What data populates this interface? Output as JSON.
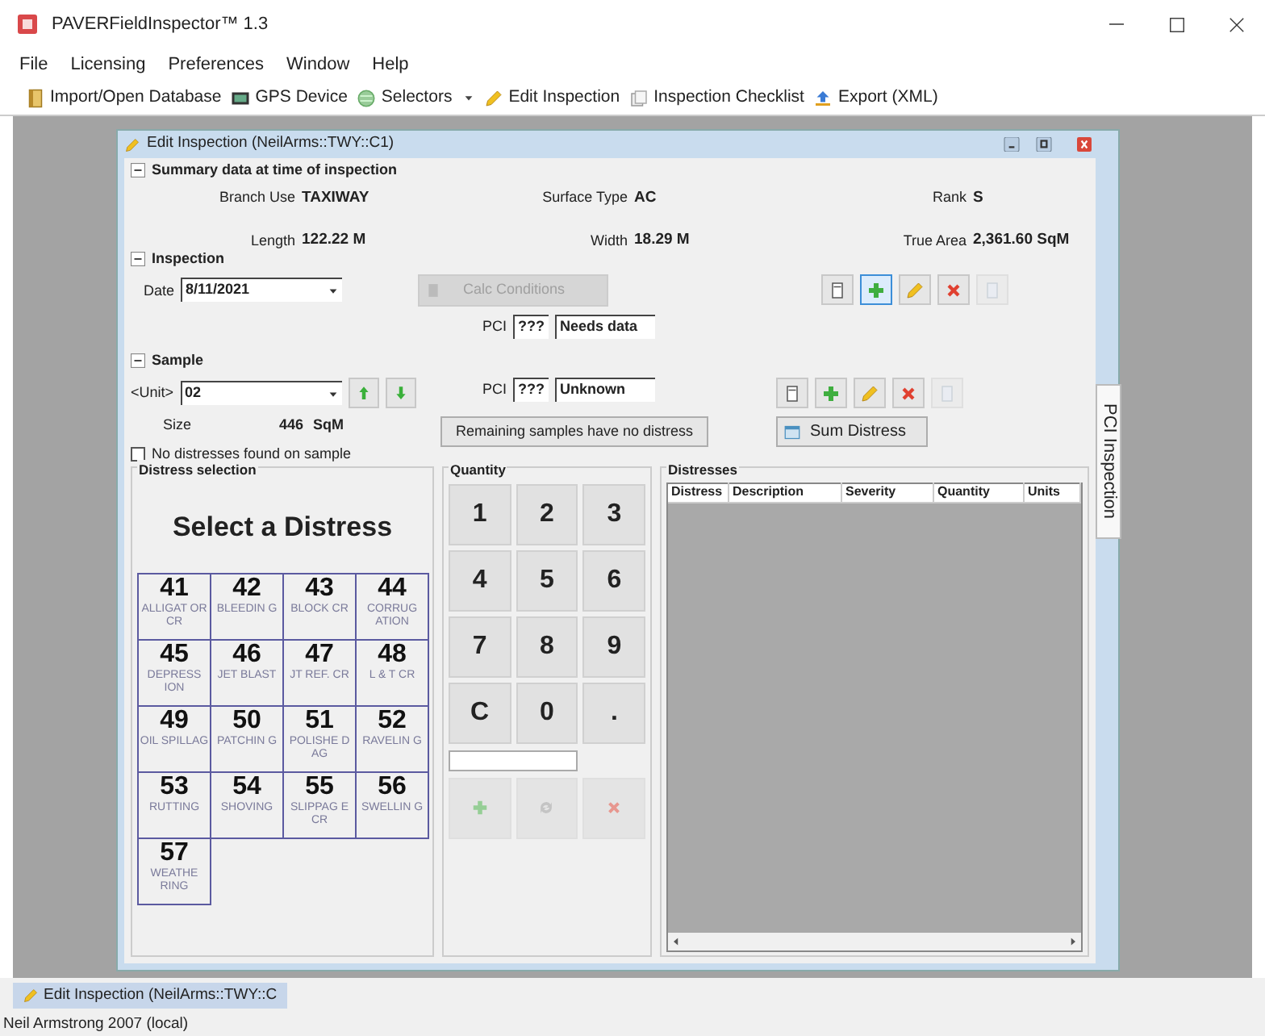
{
  "app": {
    "title": "PAVERFieldInspector™ 1.3"
  },
  "menu": [
    "File",
    "Licensing",
    "Preferences",
    "Window",
    "Help"
  ],
  "toolbar": [
    {
      "label": "Import/Open Database",
      "kind": "database",
      "has_menu": false
    },
    {
      "label": "GPS Device",
      "kind": "gps",
      "has_menu": false
    },
    {
      "label": "Selectors",
      "kind": "selectors",
      "has_menu": true
    },
    {
      "label": "Edit Inspection",
      "kind": "edit",
      "has_menu": false
    },
    {
      "label": "Inspection Checklist",
      "kind": "checklist",
      "has_menu": false
    },
    {
      "label": "Export (XML)",
      "kind": "export",
      "has_menu": false
    }
  ],
  "dialog": {
    "title": "Edit Inspection (NeilArms::TWY::C1)",
    "summary": {
      "heading": "Summary data at time of inspection",
      "expanded": true,
      "fields": [
        {
          "label": "Branch Use",
          "value": "TAXIWAY"
        },
        {
          "label": "Surface Type",
          "value": "AC"
        },
        {
          "label": "Rank",
          "value": "S"
        },
        {
          "label": "Length",
          "value": "122.22 M"
        },
        {
          "label": "Width",
          "value": "18.29 M"
        },
        {
          "label": "True Area",
          "value": "2,361.60 SqM"
        }
      ]
    },
    "inspection": {
      "heading": "Inspection",
      "expanded": true,
      "date_label": "Date",
      "date": "8/11/2021",
      "calc_button": {
        "label": "Calc Conditions",
        "disabled": true
      },
      "pci_label": "PCI",
      "pci": "???",
      "condition": "Needs data",
      "actions": [
        {
          "kind": "notes",
          "selected": false,
          "disabled": false
        },
        {
          "kind": "add",
          "selected": true,
          "disabled": false
        },
        {
          "kind": "edit",
          "selected": false,
          "disabled": false
        },
        {
          "kind": "delete",
          "selected": false,
          "disabled": false
        },
        {
          "kind": "copy",
          "selected": false,
          "disabled": true
        }
      ]
    },
    "sample": {
      "heading": "Sample",
      "expanded": true,
      "unit_label": "<Unit>",
      "unit": "02",
      "size_label": "Size",
      "size": "446",
      "size_unit": "SqM",
      "pci_label": "PCI",
      "pci": "???",
      "condition": "Unknown",
      "actions": [
        {
          "kind": "notes",
          "selected": false,
          "disabled": false
        },
        {
          "kind": "add",
          "selected": false,
          "disabled": false
        },
        {
          "kind": "edit",
          "selected": false,
          "disabled": false
        },
        {
          "kind": "delete",
          "selected": false,
          "disabled": false
        },
        {
          "kind": "copy",
          "selected": false,
          "disabled": true
        }
      ],
      "remaining_button": "Remaining samples have no distress",
      "sum_button": "Sum Distress",
      "no_distress": {
        "label": "No distresses found on sample",
        "checked": false
      }
    },
    "distress_selection": {
      "title": "Distress selection",
      "heading": "Select a Distress",
      "tiles": [
        {
          "code": "41",
          "name": "ALLIGAT OR CR"
        },
        {
          "code": "42",
          "name": "BLEEDIN G"
        },
        {
          "code": "43",
          "name": "BLOCK CR"
        },
        {
          "code": "44",
          "name": "CORRUG ATION"
        },
        {
          "code": "45",
          "name": "DEPRESS ION"
        },
        {
          "code": "46",
          "name": "JET BLAST"
        },
        {
          "code": "47",
          "name": "JT REF. CR"
        },
        {
          "code": "48",
          "name": "L & T CR"
        },
        {
          "code": "49",
          "name": "OIL SPILLAG"
        },
        {
          "code": "50",
          "name": "PATCHIN G"
        },
        {
          "code": "51",
          "name": "POLISHE D AG"
        },
        {
          "code": "52",
          "name": "RAVELIN G"
        },
        {
          "code": "53",
          "name": "RUTTING"
        },
        {
          "code": "54",
          "name": "SHOVING"
        },
        {
          "code": "55",
          "name": "SLIPPAG E CR"
        },
        {
          "code": "56",
          "name": "SWELLIN G"
        },
        {
          "code": "57",
          "name": "WEATHE RING"
        }
      ]
    },
    "quantity": {
      "title": "Quantity",
      "keys": [
        "1",
        "2",
        "3",
        "4",
        "5",
        "6",
        "7",
        "8",
        "9",
        "C",
        "0",
        "."
      ],
      "actions": [
        {
          "kind": "add",
          "disabled": true
        },
        {
          "kind": "refresh",
          "disabled": true
        },
        {
          "kind": "delete",
          "disabled": true
        }
      ]
    },
    "distresses": {
      "title": "Distresses",
      "columns": [
        "Distress",
        "Description",
        "Severity",
        "Quantity",
        "Units"
      ]
    },
    "side_tab": "PCI Inspection"
  },
  "task_tab": "Edit Inspection (NeilArms::TWY::C",
  "status_bar": "Neil Armstrong 2007 (local)"
}
